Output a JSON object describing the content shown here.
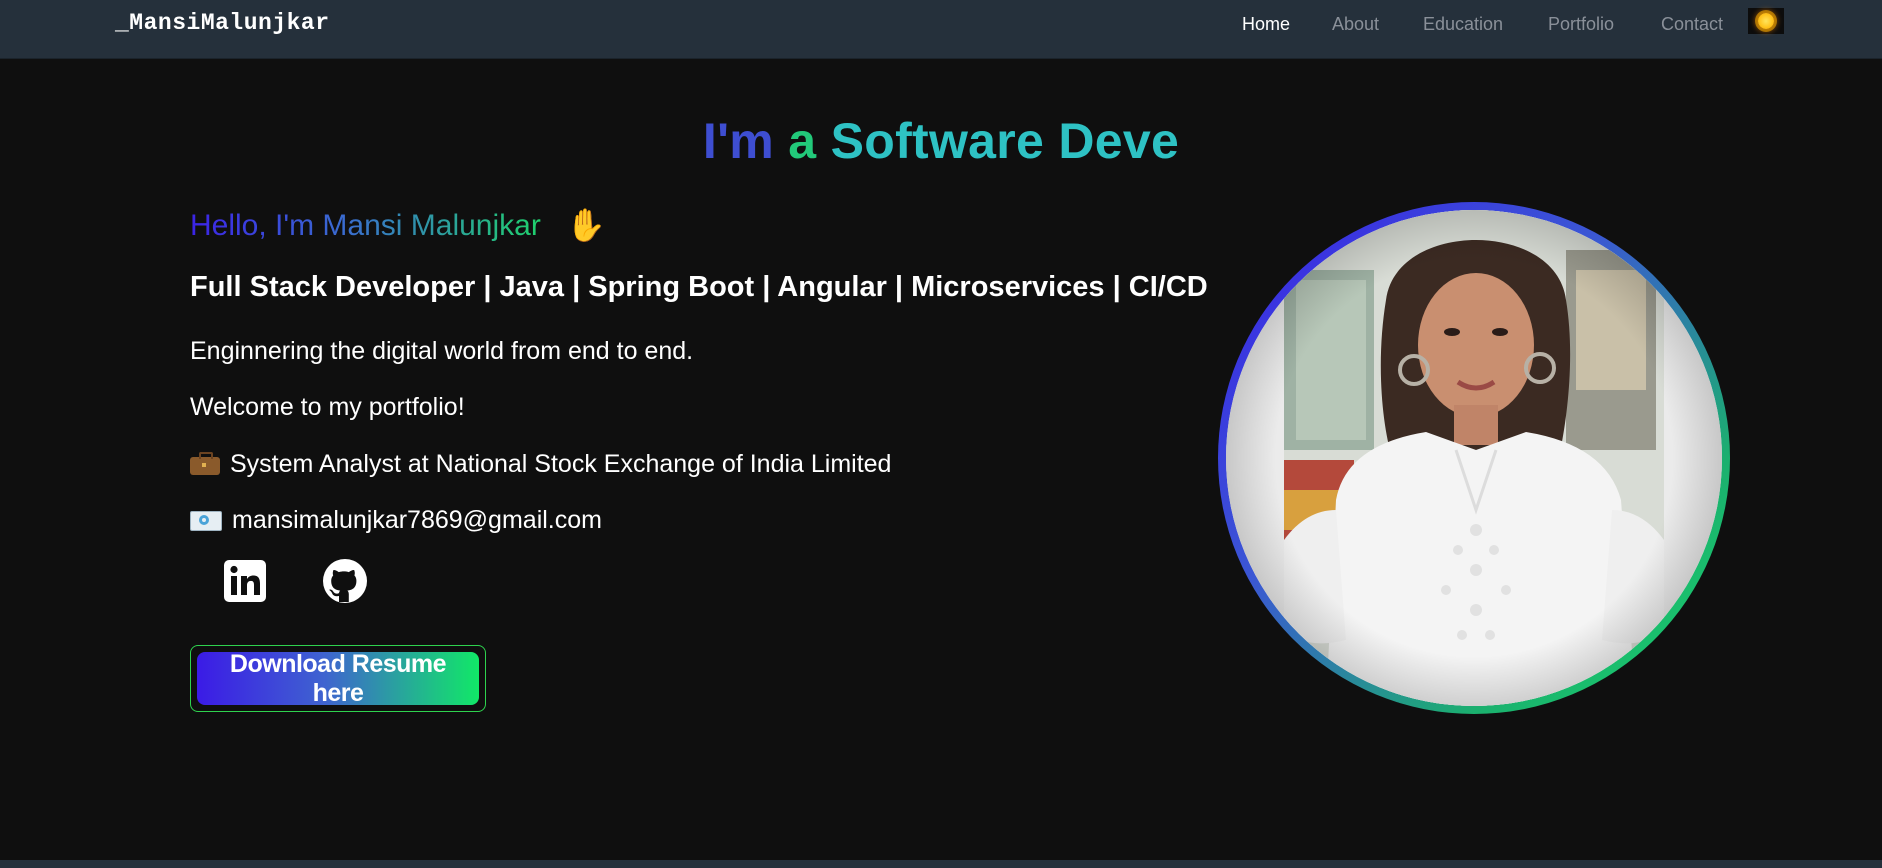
{
  "navbar": {
    "brand": "_MansiMalunjkar",
    "links": [
      {
        "label": "Home",
        "active": true
      },
      {
        "label": "About",
        "active": false
      },
      {
        "label": "Education",
        "active": false
      },
      {
        "label": "Portfolio",
        "active": false
      },
      {
        "label": "Contact",
        "active": false
      }
    ],
    "theme_toggle_icon": "sun-icon"
  },
  "hero": {
    "typed_title": {
      "part1": "I'm",
      "part2": "a",
      "part3": "Software Deve"
    },
    "greeting": "Hello, I'm Mansi Malunjkar",
    "greeting_emoji": "✋",
    "role": "Full Stack Developer | Java | Spring Boot | Angular | Microservices | CI/CD",
    "tagline": "Enginnering the digital world from end to end.",
    "welcome": "Welcome to my portfolio!",
    "job": "System Analyst at National Stock Exchange of India Limited",
    "email": "mansimalunjkar7869@gmail.com",
    "socials": [
      {
        "name": "linkedin-icon"
      },
      {
        "name": "github-icon"
      }
    ],
    "cta_label": "Download Resume here"
  },
  "colors": {
    "background": "#0f0f0f",
    "navbar": "#25303b",
    "accent_blue": "#3b23e6",
    "accent_green": "#17d66b"
  }
}
